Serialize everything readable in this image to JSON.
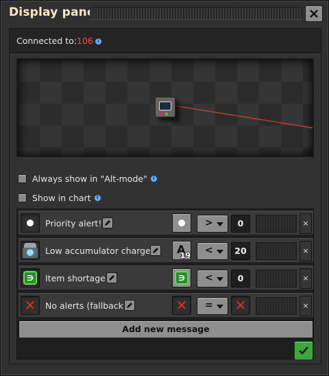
{
  "window": {
    "title": "Display panel"
  },
  "connection": {
    "label": "Connected to:",
    "value": "106",
    "info_icon": "info-icon"
  },
  "options": [
    {
      "label": "Always show in \"Alt-mode\"",
      "checked": false,
      "has_info": true
    },
    {
      "label": "Show in chart",
      "checked": false,
      "has_info": true
    }
  ],
  "messages": [
    {
      "icon": "white-dot-icon",
      "text": "Priority alert!",
      "condition_signal": "white-dot-icon",
      "comparator": ">",
      "constant": "0"
    },
    {
      "icon": "accumulator-icon",
      "text": "Low accumulator charge!",
      "condition_signal": "signal-A-icon",
      "condition_signal_letter": "A",
      "condition_signal_count": "19",
      "comparator": "<",
      "constant": "20"
    },
    {
      "icon": "electronic-circuit-icon",
      "text": "Item shortage",
      "condition_signal": "electronic-circuit-icon",
      "comparator": "<",
      "constant": "0"
    },
    {
      "icon": "red-x-icon",
      "text": "No alerts (fallback)",
      "condition_signal": "red-x-icon",
      "comparator": "=",
      "constant_icon": "red-x-icon"
    }
  ],
  "add_message_label": "Add new message",
  "colors": {
    "accent_red": "#ff4a3a",
    "confirm_green": "#3ea83e",
    "title": "#ffe6c0"
  }
}
